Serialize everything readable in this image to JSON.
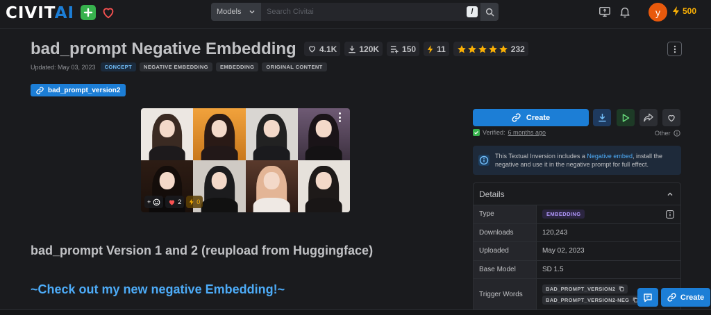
{
  "header": {
    "logo_main": "CIVIT",
    "logo_accent": "AI",
    "search_scope": "Models",
    "search_placeholder": "Search Civitai",
    "search_shortcut": "/",
    "avatar_letter": "y",
    "buzz_count": "500"
  },
  "model": {
    "title": "bad_prompt Negative Embedding",
    "stats": {
      "likes": "4.1K",
      "downloads": "120K",
      "collections": "150",
      "buzz": "11",
      "rating_count": "232",
      "rating_stars": 5
    },
    "updated": "Updated: May 03, 2023",
    "tags": [
      "CONCEPT",
      "NEGATIVE EMBEDDING",
      "EMBEDDING",
      "ORIGINAL CONTENT"
    ],
    "version": "bad_prompt_version2"
  },
  "gallery": {
    "reactions": {
      "add": "+",
      "hearts": "2",
      "buzz": "0"
    }
  },
  "content": {
    "heading": "bad_prompt Version 1 and 2 (reupload from Huggingface)",
    "link_heading": "~Check out my new negative Embedding!~"
  },
  "side": {
    "create_label": "Create",
    "verified_label": "Verified:",
    "verified_when": "6 months ago",
    "other_label": "Other",
    "alert_pre": "This Textual Inversion includes a ",
    "alert_link": "Negative embed",
    "alert_post": ", install the negative and use it in the negative prompt for full effect."
  },
  "details": {
    "title": "Details",
    "type_label": "Type",
    "type_value": "EMBEDDING",
    "downloads_label": "Downloads",
    "downloads_value": "120,243",
    "uploaded_label": "Uploaded",
    "uploaded_value": "May 02, 2023",
    "base_model_label": "Base Model",
    "base_model_value": "SD 1.5",
    "trigger_label": "Trigger Words",
    "triggers": [
      "BAD_PROMPT_VERSION2",
      "BAD_PROMPT_VERSION2-NEG"
    ]
  },
  "floating": {
    "create_label": "Create"
  },
  "colors": {
    "accent": "#1c7ed6",
    "buzz": "#fab005",
    "star": "#fab005",
    "green": "#37b24d"
  }
}
